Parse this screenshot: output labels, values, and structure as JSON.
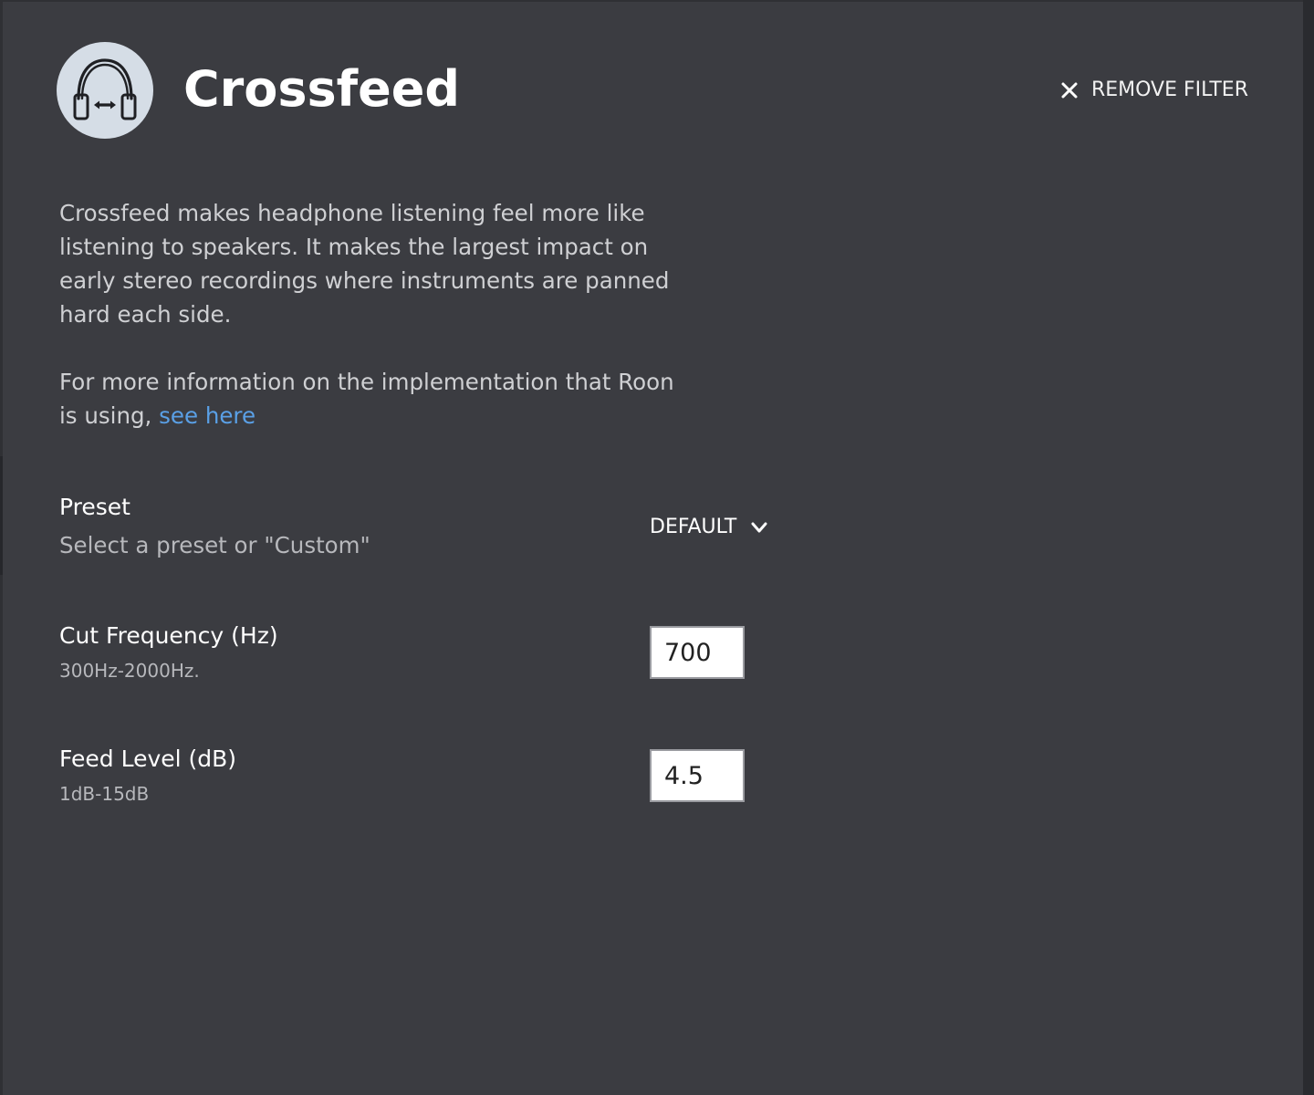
{
  "header": {
    "title": "Crossfeed",
    "icon": "headphones-crossfeed-icon",
    "remove_label": "REMOVE FILTER"
  },
  "description": {
    "paragraph1": "Crossfeed makes headphone listening feel more like listening to speakers. It makes the largest impact on early stereo recordings where instruments are panned hard each side.",
    "paragraph2_prefix": "For more information on the implementation that Roon is using, ",
    "link_text": "see here"
  },
  "settings": {
    "preset": {
      "label": "Preset",
      "hint": "Select a preset or \"Custom\"",
      "value": "DEFAULT"
    },
    "cut_frequency": {
      "label": "Cut Frequency (Hz)",
      "hint": "300Hz-2000Hz.",
      "value": "700"
    },
    "feed_level": {
      "label": "Feed Level (dB)",
      "hint": "1dB-15dB",
      "value": "4.5"
    }
  },
  "colors": {
    "background": "#3b3c41",
    "link": "#5aa0e6",
    "avatar": "#d5dde6"
  }
}
